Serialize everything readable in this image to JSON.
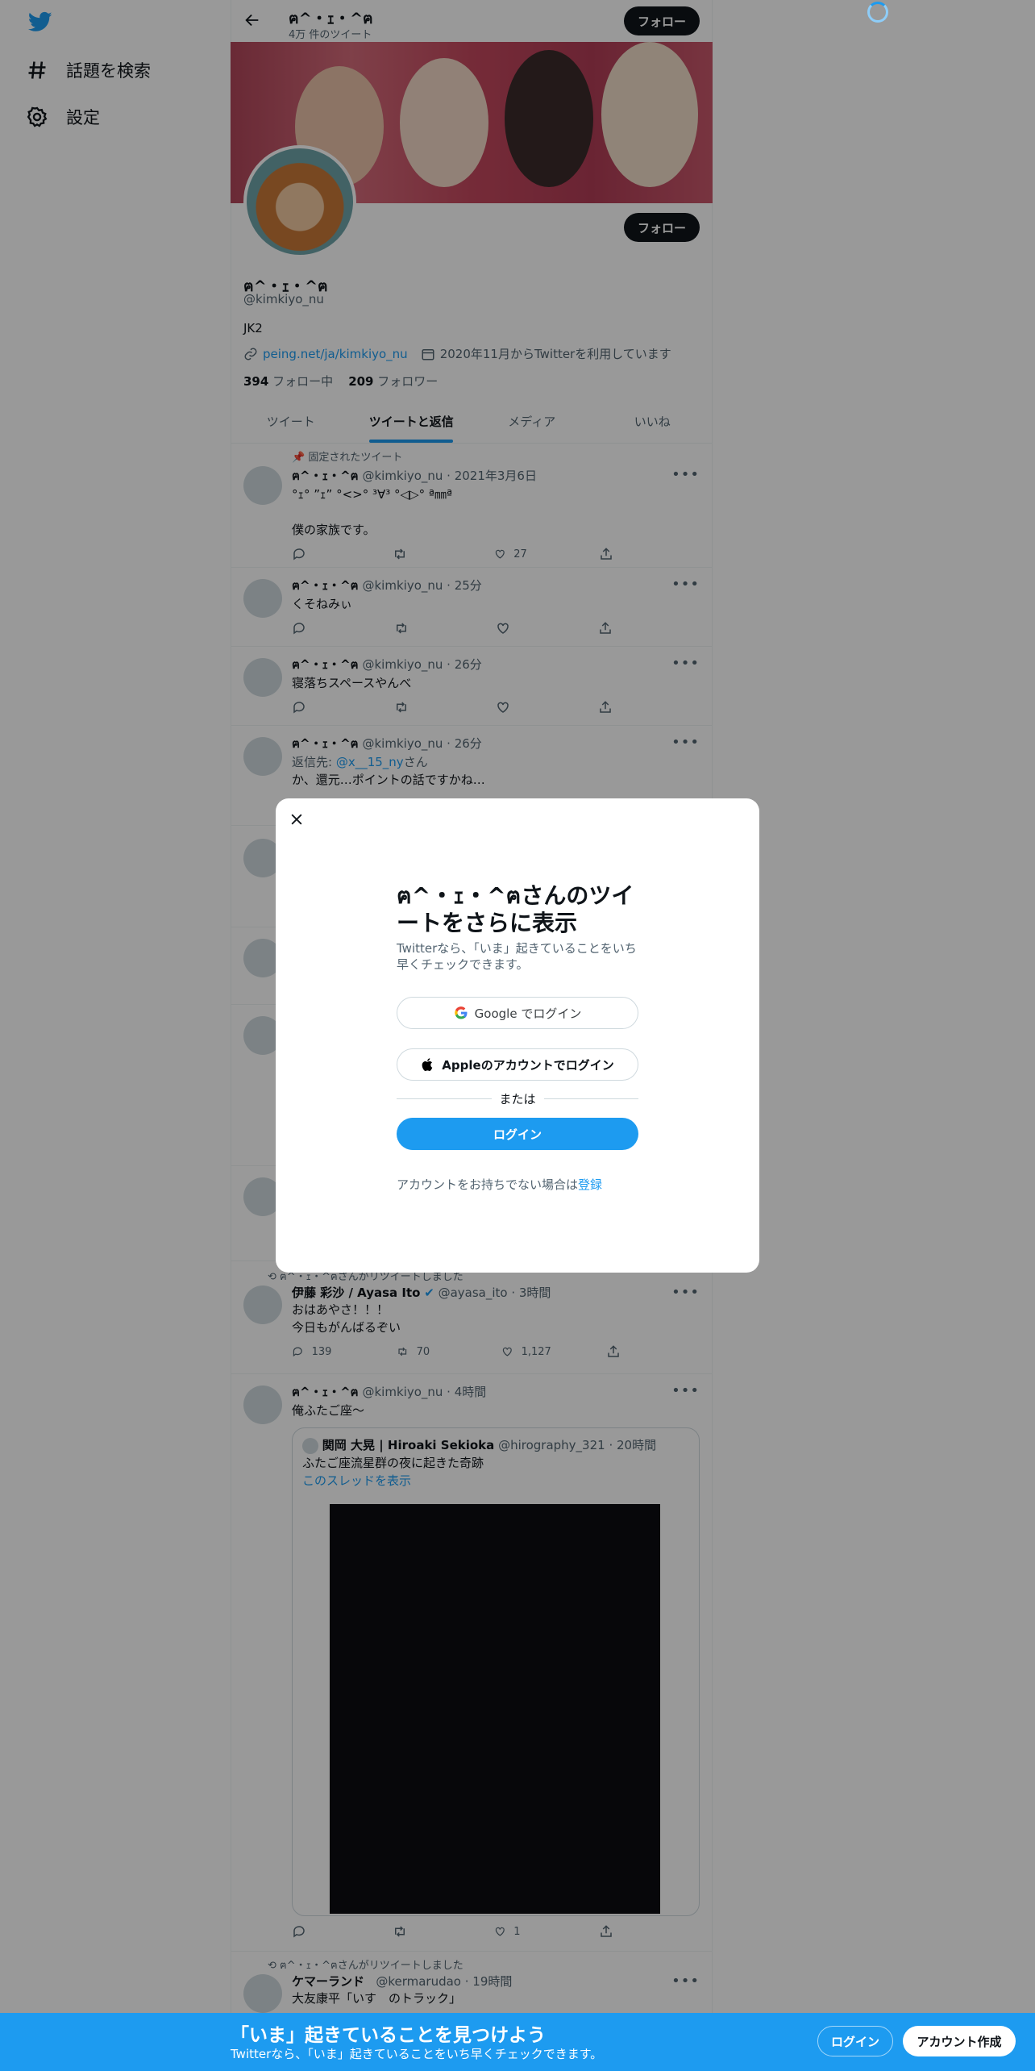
{
  "nav": {
    "explore": "話題を検索",
    "settings": "設定"
  },
  "header": {
    "title": "ฅ^・ｪ・^ฅ",
    "sub": "4万 件のツイート",
    "follow": "フォロー"
  },
  "profile": {
    "follow": "フォロー",
    "name": "ฅ^・ｪ・^ฅ",
    "handle": "@kimkiyo_nu",
    "bio": "JK2",
    "link": "peing.net/ja/kimkiyo_nu",
    "joined": "2020年11月からTwitterを利用しています",
    "following_count": "394",
    "following_label": "フォロー中",
    "followers_count": "209",
    "followers_label": "フォロワー"
  },
  "tabs": [
    "ツイート",
    "ツイートと返信",
    "メディア",
    "いいね"
  ],
  "tweets": [
    {
      "pinned": "固定されたツイート",
      "name": "ฅ^・ｪ・^ฅ",
      "meta": "@kimkiyo_nu · 2021年3月6日",
      "line1": "°ｪ°  ”ｪ”  °<>°  ³∀³  °◁▷°  ª㎜ª",
      "line2": "僕の家族です。",
      "likes": "27"
    },
    {
      "name": "ฅ^・ｪ・^ฅ",
      "meta": "@kimkiyo_nu · 25分",
      "text": "くそねみぃ"
    },
    {
      "name": "ฅ^・ｪ・^ฅ",
      "meta": "@kimkiyo_nu · 26分",
      "text": "寝落ちスペースやんべ"
    },
    {
      "name": "ฅ^・ｪ・^ฅ",
      "meta": "@kimkiyo_nu · 26分",
      "reply_prefix": "返信先: ",
      "reply_to": "@x__15_ny",
      "reply_suffix": "さん",
      "text": "か、還元…ポイントの話ですかね…"
    },
    {
      "retweeted": "ฅ^・ｪ・^ฅさんがリツイートしました",
      "name": "伊藤 彩沙 / Ayasa Ito",
      "meta": "@ayasa_ito · 3時間",
      "line1": "おはあやさ！！！",
      "line2": "今日もがんばるぞい",
      "replies": "139",
      "retweets": "70",
      "likes": "1,127"
    },
    {
      "name": "ฅ^・ｪ・^ฅ",
      "meta": "@kimkiyo_nu · 4時間",
      "text": "俺ふたご座〜",
      "quote_name": "関岡 大晃 | Hiroaki Sekioka",
      "quote_meta": "@hirography_321 · 20時間",
      "quote_text": "ふたご座流星群の夜に起きた奇跡",
      "quote_link": "このスレッドを表示",
      "likes": "1"
    },
    {
      "retweeted": "ฅ^・ｪ・^ฅさんがリツイートしました",
      "name": "ケマーランド",
      "meta": "@kermarudao · 19時間",
      "text": "大友康平「いす　のトラック」"
    }
  ],
  "modal": {
    "title": "ฅ^・ｪ・^ฅさんのツイートをさらに表示",
    "desc": "Twitterなら、「いま」起きていることをいち早くチェックできます。",
    "google": "Google でログイン",
    "apple": "Appleのアカウントでログイン",
    "or": "または",
    "login": "ログイン",
    "signup_prefix": "アカウントをお持ちでない場合は",
    "signup_link": "登録"
  },
  "bottom": {
    "title": "「いま」起きていることを見つけよう",
    "sub": "Twitterなら、「いま」起きていることをいち早くチェックできます。",
    "login": "ログイン",
    "signup": "アカウント作成"
  },
  "colors": {
    "accent": "#1d9bf0",
    "text": "#0f1419",
    "muted": "#536471"
  }
}
